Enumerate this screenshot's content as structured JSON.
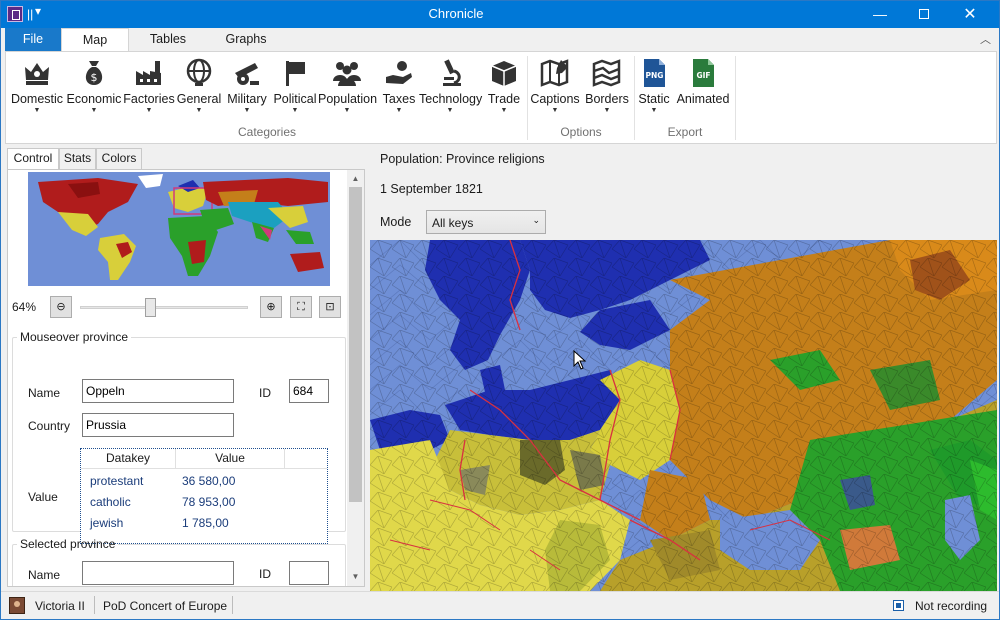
{
  "window": {
    "title": "Chronicle",
    "quick_access": "▾"
  },
  "ribbon": {
    "tabs": [
      {
        "label": "File"
      },
      {
        "label": "Map"
      },
      {
        "label": "Tables"
      },
      {
        "label": "Graphs"
      }
    ],
    "groups": [
      {
        "label": "Categories",
        "buttons": [
          {
            "label": "Domestic",
            "icon": "crown-icon"
          },
          {
            "label": "Economic",
            "icon": "money-bag-icon"
          },
          {
            "label": "Factories",
            "icon": "factory-icon"
          },
          {
            "label": "General",
            "icon": "globe-icon"
          },
          {
            "label": "Military",
            "icon": "cannon-icon"
          },
          {
            "label": "Political",
            "icon": "flag-icon"
          },
          {
            "label": "Population",
            "icon": "people-icon"
          },
          {
            "label": "Taxes",
            "icon": "hand-money-icon"
          },
          {
            "label": "Technology",
            "icon": "microscope-icon"
          },
          {
            "label": "Trade",
            "icon": "crate-icon"
          }
        ]
      },
      {
        "label": "Options",
        "buttons": [
          {
            "label": "Captions",
            "icon": "map-pencil-icon"
          },
          {
            "label": "Borders",
            "icon": "map-borders-icon"
          }
        ]
      },
      {
        "label": "Export",
        "buttons": [
          {
            "label": "Static",
            "icon": "png-file-icon",
            "badge": "PNG"
          },
          {
            "label": "Animated",
            "icon": "gif-file-icon",
            "badge": "GIF"
          }
        ]
      }
    ]
  },
  "left_panel": {
    "tabs": [
      {
        "label": "Control"
      },
      {
        "label": "Stats"
      },
      {
        "label": "Colors"
      }
    ],
    "zoom": {
      "label": "64%",
      "level": 0.42
    },
    "mouseover": {
      "title": "Mouseover province",
      "name_label": "Name",
      "name_value": "Oppeln",
      "id_label": "ID",
      "id_value": "684",
      "country_label": "Country",
      "country_value": "Prussia",
      "value_label": "Value",
      "table": {
        "headers": [
          "Datakey",
          "Value"
        ],
        "rows": [
          {
            "key": "protestant",
            "value": "36 580,00"
          },
          {
            "key": "catholic",
            "value": "78 953,00"
          },
          {
            "key": "jewish",
            "value": "1 785,00"
          }
        ]
      }
    },
    "selected": {
      "title": "Selected province",
      "name_label": "Name",
      "id_label": "ID"
    }
  },
  "map_panel": {
    "title": "Population: Province religions",
    "date": "1 September 1821",
    "mode_label": "Mode",
    "mode_value": "All keys"
  },
  "status": {
    "game": "Victoria II",
    "mod": "PoD Concert of Europe",
    "recording": "Not recording"
  },
  "colors": {
    "accent": "#0078d7",
    "file_tab": "#1979ca",
    "ocean": "#6f8fd6",
    "protestant": "#1f2fb0",
    "catholic": "#d8cf3a",
    "orthodox": "#c47f1a",
    "sunni": "#2aa02a",
    "jewish": "#5a5a5a"
  }
}
